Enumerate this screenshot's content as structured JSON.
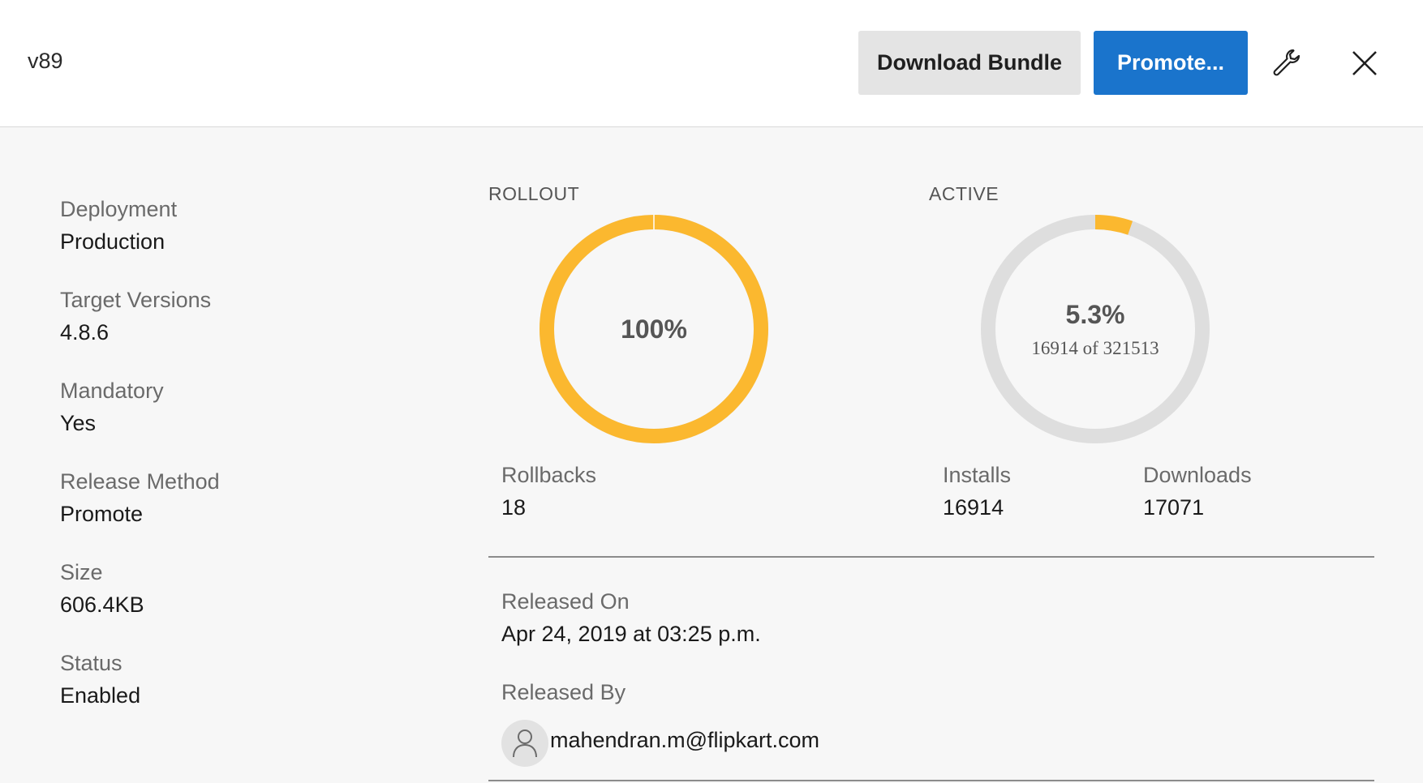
{
  "header": {
    "version": "v89",
    "download_label": "Download Bundle",
    "promote_label": "Promote..."
  },
  "icons": {
    "settings": "wrench-icon",
    "close": "close-icon",
    "user": "user-icon"
  },
  "colors": {
    "accent": "#fbb82f",
    "primary_button": "#1a74cc",
    "track": "#dedede"
  },
  "details": [
    {
      "label": "Deployment",
      "value": "Production"
    },
    {
      "label": "Target Versions",
      "value": "4.8.6"
    },
    {
      "label": "Mandatory",
      "value": "Yes"
    },
    {
      "label": "Release Method",
      "value": "Promote"
    },
    {
      "label": "Size",
      "value": "606.4KB"
    },
    {
      "label": "Status",
      "value": "Enabled"
    }
  ],
  "rollout": {
    "title": "ROLLOUT",
    "percent_label": "100%",
    "fraction": 1.0
  },
  "active": {
    "title": "ACTIVE",
    "percent_label": "5.3%",
    "sub_label": "16914 of 321513",
    "fraction": 0.053
  },
  "stats": {
    "rollbacks": {
      "label": "Rollbacks",
      "value": "18"
    },
    "installs": {
      "label": "Installs",
      "value": "16914"
    },
    "downloads": {
      "label": "Downloads",
      "value": "17071"
    }
  },
  "release": {
    "released_on_label": "Released On",
    "released_on": "Apr 24, 2019 at 03:25 p.m.",
    "released_by_label": "Released By",
    "released_by": "mahendran.m@flipkart.com"
  }
}
